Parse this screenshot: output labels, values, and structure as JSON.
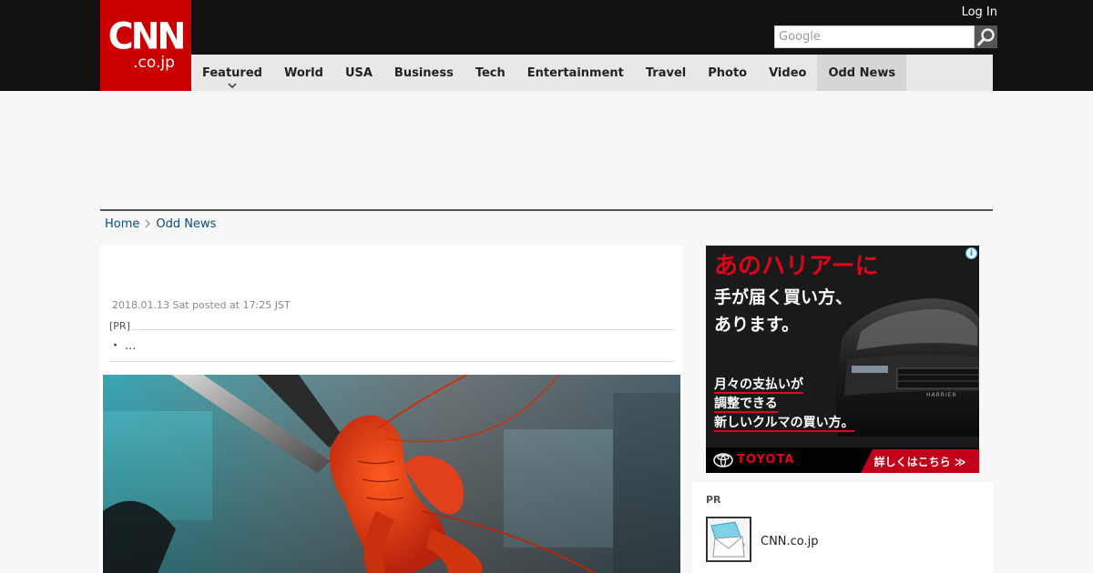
{
  "header": {
    "logo_main": "CNN",
    "logo_sub": ".co.jp",
    "login_label": "Log In",
    "search_placeholder": "Google"
  },
  "nav": {
    "items": [
      {
        "label": "Featured"
      },
      {
        "label": "World"
      },
      {
        "label": "USA"
      },
      {
        "label": "Business"
      },
      {
        "label": "Tech"
      },
      {
        "label": "Entertainment"
      },
      {
        "label": "Travel"
      },
      {
        "label": "Photo"
      },
      {
        "label": "Video"
      },
      {
        "label": "Odd News",
        "active": true
      }
    ]
  },
  "breadcrumb": {
    "home": "Home",
    "current": "Odd News"
  },
  "article": {
    "posted": "2018.01.13 Sat posted at 17:25 JST",
    "pr_label": "[PR]",
    "pr_bullet": "・",
    "pr_link": "..."
  },
  "side_ad": {
    "headline": "あのハリアーに",
    "subhead": "手が届く買い方、あります。",
    "line1": "月々の支払いが",
    "line2": "調整できる",
    "line3": "新しいクルマの買い方。",
    "brand": "TOYOTA",
    "cta": "詳しくはこちら ≫",
    "car_badge": "HARRIER",
    "info_icon_text": "i"
  },
  "pr_widget": {
    "label": "PR",
    "item_title": "CNN.co.jp"
  },
  "colors": {
    "brand_red": "#cc0000",
    "topbar": "#111111",
    "nav_bg": "#e8e8e8",
    "link_blue": "#0d4a78"
  }
}
